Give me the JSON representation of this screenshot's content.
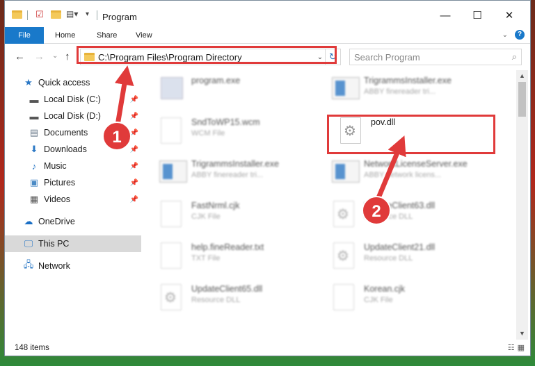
{
  "window": {
    "title": "Program",
    "controls": {
      "minimize": "—",
      "maximize": "☐",
      "close": "✕"
    }
  },
  "ribbon": {
    "tabs": [
      {
        "label": "File"
      },
      {
        "label": "Home"
      },
      {
        "label": "Share"
      },
      {
        "label": "View"
      }
    ],
    "help": "?"
  },
  "navigation": {
    "back": "←",
    "forward": "→",
    "recent": "⌄",
    "up": "↑",
    "address": "C:\\Program Files\\Program Directory",
    "search_placeholder": "Search Program"
  },
  "sidebar": {
    "items": [
      {
        "label": "Quick access",
        "icon": "star-icon"
      },
      {
        "label": "Local Disk (C:)",
        "icon": "drive-icon"
      },
      {
        "label": "Local Disk (D:)",
        "icon": "drive-icon"
      },
      {
        "label": "Documents",
        "icon": "documents-icon"
      },
      {
        "label": "Downloads",
        "icon": "download-icon"
      },
      {
        "label": "Music",
        "icon": "music-icon"
      },
      {
        "label": "Pictures",
        "icon": "pictures-icon"
      },
      {
        "label": "Videos",
        "icon": "videos-icon"
      },
      {
        "label": "OneDrive",
        "icon": "cloud-icon"
      },
      {
        "label": "This PC",
        "icon": "computer-icon"
      },
      {
        "label": "Network",
        "icon": "network-icon"
      }
    ]
  },
  "files": [
    {
      "name": "program.exe",
      "type": ""
    },
    {
      "name": "TrigrammsInstaller.exe",
      "type": "ABBY finereader tri..."
    },
    {
      "name": "SndToWP15.wcm",
      "type": "WCM File"
    },
    {
      "name": "pov.dll",
      "type": ""
    },
    {
      "name": "TrigrammsInstaller.exe",
      "type": "ABBY finereader tri..."
    },
    {
      "name": "NetworkLicenseServer.exe",
      "type": "ABBY network licens..."
    },
    {
      "name": "FastNrml.cjk",
      "type": "CJK File"
    },
    {
      "name": "UpdateClient63.dll",
      "type": "Resource DLL"
    },
    {
      "name": "help.fineReader.txt",
      "type": "TXT File"
    },
    {
      "name": "UpdateClient21.dll",
      "type": "Resource DLL"
    },
    {
      "name": "UpdateClient65.dll",
      "type": "Resource DLL"
    },
    {
      "name": "Korean.cjk",
      "type": "CJK File"
    }
  ],
  "status": {
    "count": "148 items"
  },
  "annotations": [
    {
      "label": "1"
    },
    {
      "label": "2"
    }
  ],
  "colors": {
    "accent": "#1979ca",
    "highlight": "#e03a3a"
  }
}
